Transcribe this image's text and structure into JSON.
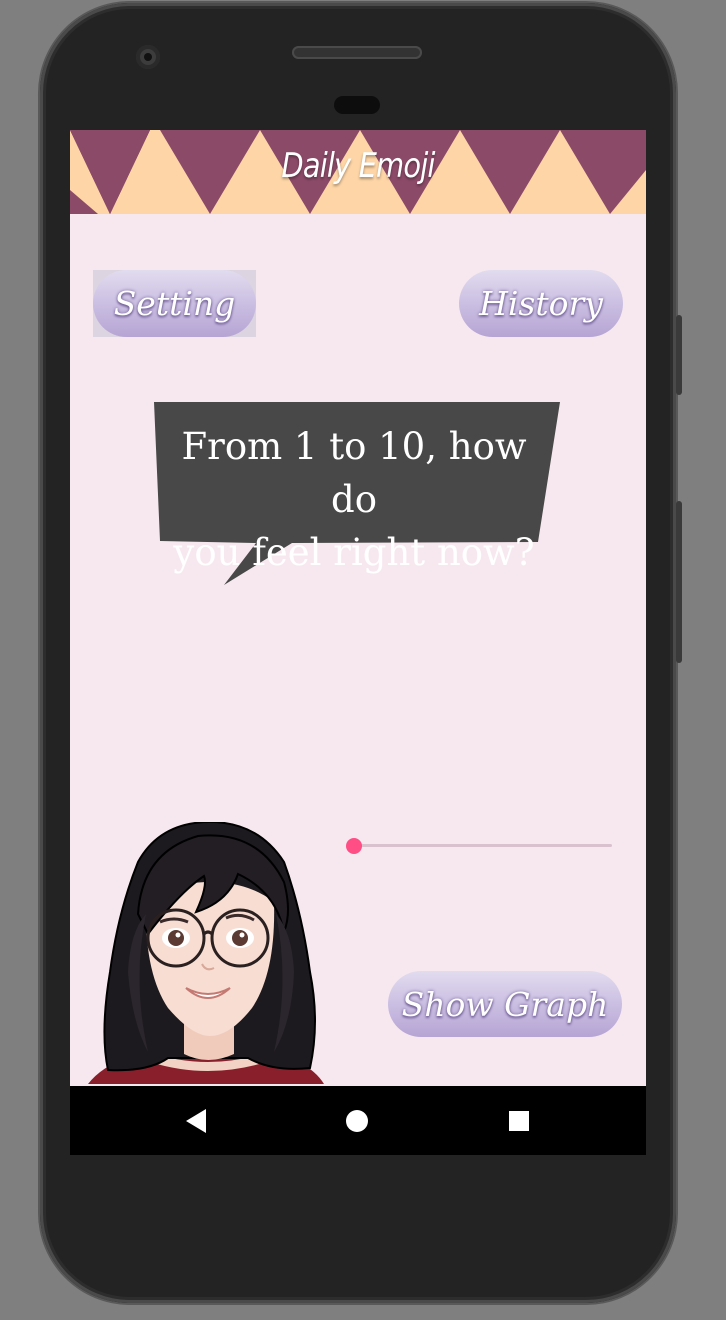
{
  "app": {
    "title": "Daily Emoji"
  },
  "top_buttons": {
    "setting_label": "Setting",
    "history_label": "History"
  },
  "prompt": {
    "line1": "From 1 to 10, how do",
    "line2": "you feel right now?"
  },
  "mood_slider": {
    "min": 1,
    "max": 10,
    "value": 1
  },
  "show_graph_label": "Show Graph",
  "nav": {
    "back_icon": "back-triangle-icon",
    "home_icon": "home-circle-icon",
    "recents_icon": "recents-square-icon"
  },
  "colors": {
    "screen_bg": "#f7e8ef",
    "header_bg": "#fdd5a6",
    "header_triangles": "#8b4a68",
    "bubble_bg": "#484848",
    "slider_accent": "#ff4d85",
    "button_gradient_end": "#b6a4d4"
  }
}
